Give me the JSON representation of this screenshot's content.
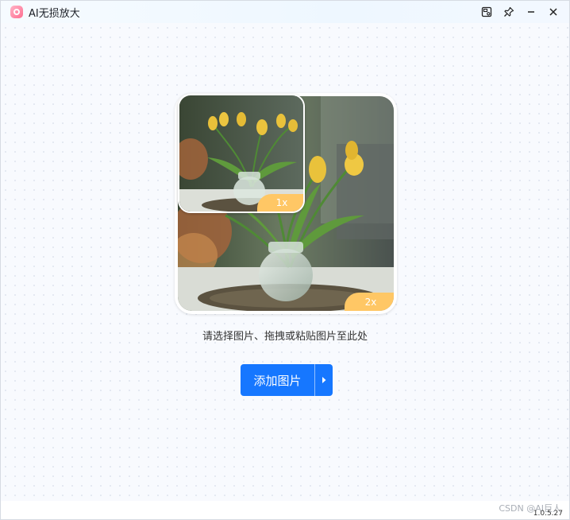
{
  "app": {
    "title": "AI无损放大"
  },
  "window_controls": {
    "snapshot": "snapshot-icon",
    "pin": "pin-icon",
    "minimize": "minimize-icon",
    "close": "close-icon"
  },
  "preview": {
    "badge_large": "2x",
    "badge_small": "1x"
  },
  "main": {
    "hint": "请选择图片、拖拽或粘贴图片至此处",
    "add_button_label": "添加图片"
  },
  "footer": {
    "version": "1.0.5.27",
    "watermark": "CSDN @AI巨人"
  },
  "colors": {
    "accent": "#1677ff",
    "badge": "#ffc765"
  }
}
